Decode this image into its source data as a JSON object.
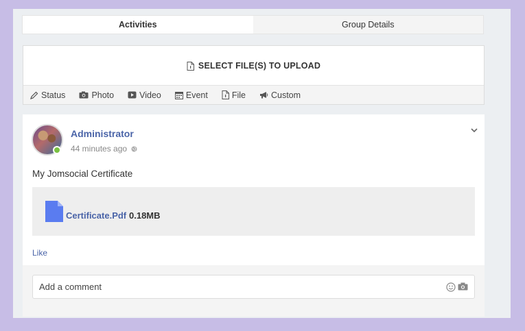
{
  "tabs": [
    {
      "label": "Activities",
      "active": true
    },
    {
      "label": "Group Details",
      "active": false
    }
  ],
  "composer": {
    "upload_label": "SELECT FILE(S) TO UPLOAD",
    "tabs": [
      {
        "label": "Status",
        "icon": "pencil-icon"
      },
      {
        "label": "Photo",
        "icon": "camera-icon"
      },
      {
        "label": "Video",
        "icon": "video-icon"
      },
      {
        "label": "Event",
        "icon": "calendar-icon"
      },
      {
        "label": "File",
        "icon": "file-icon"
      },
      {
        "label": "Custom",
        "icon": "megaphone-icon"
      }
    ]
  },
  "post": {
    "author": "Administrator",
    "time": "44 minutes ago",
    "privacy_icon": "globe-icon",
    "text": "My Jomsocial Certificate",
    "attachment": {
      "name": "Certificate.Pdf",
      "size": "0.18MB"
    },
    "like_label": "Like",
    "comment": {
      "placeholder": "Add a comment"
    }
  },
  "colors": {
    "background": "#c7bde6",
    "link": "#4a64a8",
    "file_icon": "#5a7cf0",
    "online": "#7ac142"
  }
}
